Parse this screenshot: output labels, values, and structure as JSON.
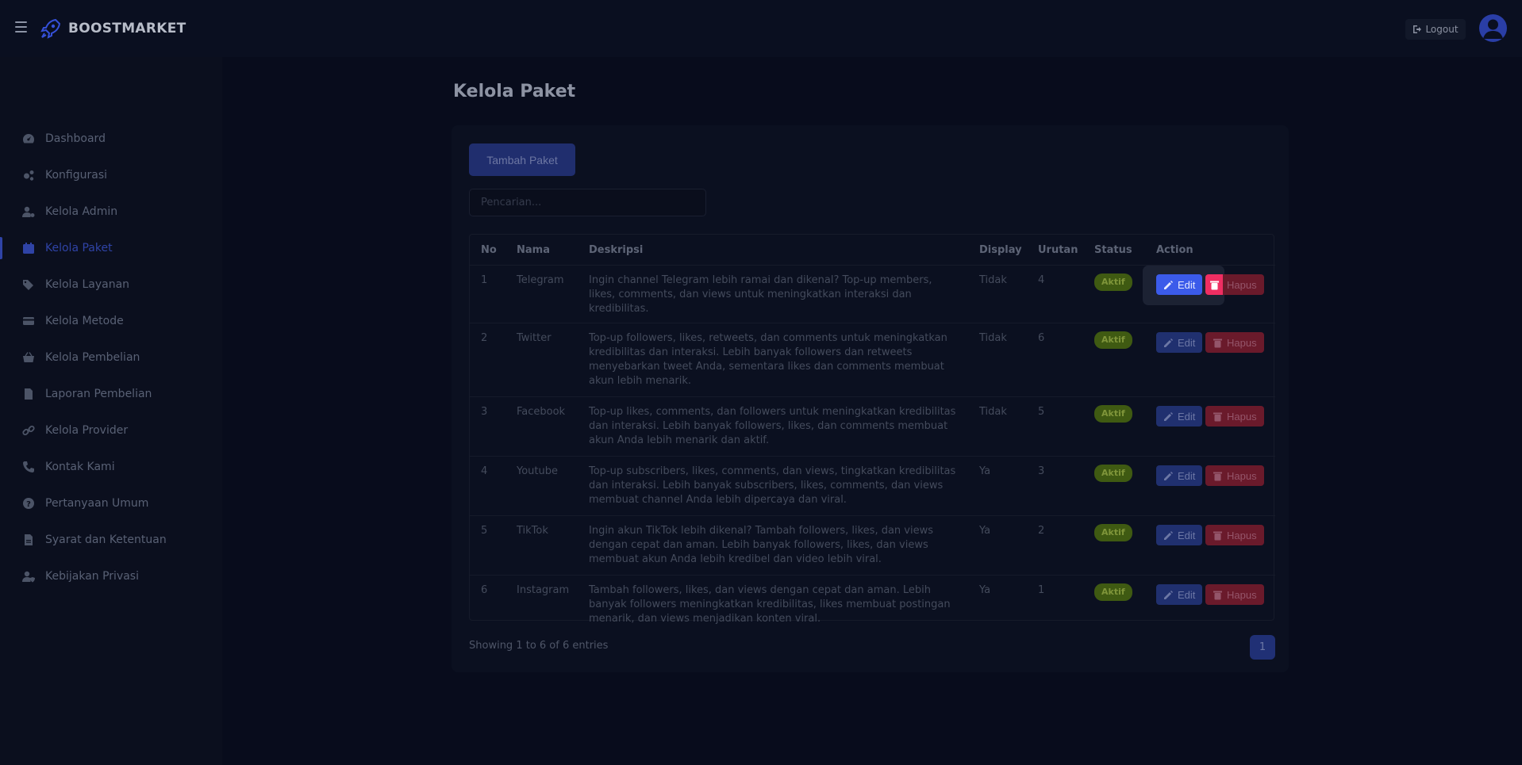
{
  "brand": {
    "name": "BOOSTMARKET"
  },
  "header": {
    "logout_label": "Logout"
  },
  "sidebar": {
    "items": [
      {
        "label": "Dashboard",
        "icon": "dashboard-icon"
      },
      {
        "label": "Konfigurasi",
        "icon": "cogs-icon"
      },
      {
        "label": "Kelola Admin",
        "icon": "user-cog-icon"
      },
      {
        "label": "Kelola Paket",
        "icon": "calendar-icon",
        "active": true
      },
      {
        "label": "Kelola Layanan",
        "icon": "tags-icon"
      },
      {
        "label": "Kelola Metode",
        "icon": "credit-card-icon"
      },
      {
        "label": "Kelola Pembelian",
        "icon": "basket-icon"
      },
      {
        "label": "Laporan Pembelian",
        "icon": "file-icon"
      },
      {
        "label": "Kelola Provider",
        "icon": "link-icon"
      },
      {
        "label": "Kontak Kami",
        "icon": "phone-icon"
      },
      {
        "label": "Pertanyaan Umum",
        "icon": "question-icon"
      },
      {
        "label": "Syarat dan Ketentuan",
        "icon": "file-alt-icon"
      },
      {
        "label": "Kebijakan Privasi",
        "icon": "user-shield-icon"
      }
    ]
  },
  "page": {
    "title": "Kelola Paket",
    "add_button": "Tambah Paket",
    "search_placeholder": "Pencarian..."
  },
  "table": {
    "headers": [
      "No",
      "Nama",
      "Deskripsi",
      "Display",
      "Urutan",
      "Status",
      "Action"
    ],
    "edit_label": "Edit",
    "delete_label": "Hapus",
    "rows": [
      {
        "no": "1",
        "nama": "Telegram",
        "deskripsi": "Ingin channel Telegram lebih ramai dan dikenal? Top-up members, likes, comments, dan views untuk meningkatkan interaksi dan kredibilitas.",
        "display": "Tidak",
        "urutan": "4",
        "status": "Aktif"
      },
      {
        "no": "2",
        "nama": "Twitter",
        "deskripsi": "Top-up followers, likes, retweets, dan comments untuk meningkatkan kredibilitas dan interaksi. Lebih banyak followers dan retweets menyebarkan tweet Anda, sementara likes dan comments membuat akun lebih menarik.",
        "display": "Tidak",
        "urutan": "6",
        "status": "Aktif"
      },
      {
        "no": "3",
        "nama": "Facebook",
        "deskripsi": "Top-up likes, comments, dan followers untuk meningkatkan kredibilitas dan interaksi. Lebih banyak followers, likes, dan comments membuat akun Anda lebih menarik dan aktif.",
        "display": "Tidak",
        "urutan": "5",
        "status": "Aktif"
      },
      {
        "no": "4",
        "nama": "Youtube",
        "deskripsi": "Top-up subscribers, likes, comments, dan views, tingkatkan kredibilitas dan interaksi. Lebih banyak subscribers, likes, comments, dan views membuat channel Anda lebih dipercaya dan viral.",
        "display": "Ya",
        "urutan": "3",
        "status": "Aktif"
      },
      {
        "no": "5",
        "nama": "TikTok",
        "deskripsi": "Ingin akun TikTok lebih dikenal? Tambah followers, likes, dan views dengan cepat dan aman. Lebih banyak followers, likes, dan views membuat akun Anda lebih kredibel dan video lebih viral.",
        "display": "Ya",
        "urutan": "2",
        "status": "Aktif"
      },
      {
        "no": "6",
        "nama": "Instagram",
        "deskripsi": "Tambah followers, likes, dan views dengan cepat dan aman. Lebih banyak followers meningkatkan kredibilitas, likes membuat postingan menarik, dan views menjadikan konten viral.",
        "display": "Ya",
        "urutan": "1",
        "status": "Aktif"
      }
    ]
  },
  "footer": {
    "info": "Showing 1 to 6 of 6 entries",
    "page": "1"
  },
  "colors": {
    "accent": "#3b5bea",
    "danger": "#ef2e62",
    "success": "#3f5a12"
  }
}
